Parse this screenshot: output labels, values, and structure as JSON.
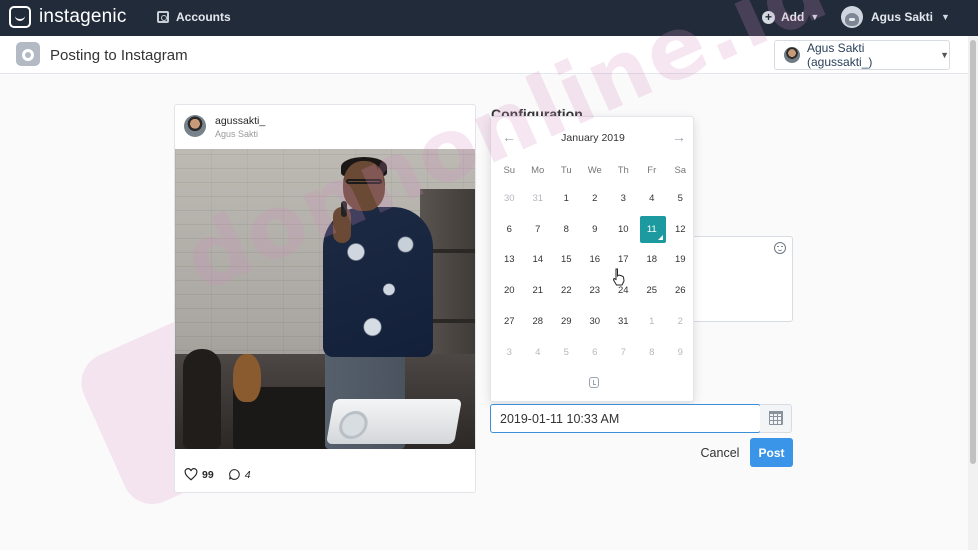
{
  "nav": {
    "brand": "instagenic",
    "accounts": "Accounts",
    "add": "Add",
    "user": "Agus Sakti"
  },
  "page": {
    "title": "Posting to Instagram",
    "account_select": "Agus Sakti (agussakti_)"
  },
  "post": {
    "username": "agussakti_",
    "fullname": "Agus Sakti",
    "likes": "99",
    "comments": "4"
  },
  "config": {
    "title": "Configuration"
  },
  "datepicker": {
    "month_label": "January 2019",
    "prev": "←",
    "next": "→",
    "weekdays": [
      "Su",
      "Mo",
      "Tu",
      "We",
      "Th",
      "Fr",
      "Sa"
    ],
    "days": [
      {
        "d": "30",
        "other": true
      },
      {
        "d": "31",
        "other": true
      },
      {
        "d": "1"
      },
      {
        "d": "2"
      },
      {
        "d": "3"
      },
      {
        "d": "4"
      },
      {
        "d": "5"
      },
      {
        "d": "6"
      },
      {
        "d": "7"
      },
      {
        "d": "8"
      },
      {
        "d": "9"
      },
      {
        "d": "10"
      },
      {
        "d": "11",
        "selected": true
      },
      {
        "d": "12"
      },
      {
        "d": "13"
      },
      {
        "d": "14"
      },
      {
        "d": "15"
      },
      {
        "d": "16"
      },
      {
        "d": "17"
      },
      {
        "d": "18"
      },
      {
        "d": "19"
      },
      {
        "d": "20"
      },
      {
        "d": "21"
      },
      {
        "d": "22"
      },
      {
        "d": "23"
      },
      {
        "d": "24"
      },
      {
        "d": "25"
      },
      {
        "d": "26"
      },
      {
        "d": "27"
      },
      {
        "d": "28"
      },
      {
        "d": "29"
      },
      {
        "d": "30"
      },
      {
        "d": "31"
      },
      {
        "d": "1",
        "other": true
      },
      {
        "d": "2",
        "other": true
      },
      {
        "d": "3",
        "other": true
      },
      {
        "d": "4",
        "other": true
      },
      {
        "d": "5",
        "other": true
      },
      {
        "d": "6",
        "other": true
      },
      {
        "d": "7",
        "other": true
      },
      {
        "d": "8",
        "other": true
      },
      {
        "d": "9",
        "other": true
      }
    ],
    "selected_color": "#1d9aa0"
  },
  "schedule": {
    "value": "2019-01-11 10:33 AM"
  },
  "buttons": {
    "cancel": "Cancel",
    "post": "Post",
    "post_color": "#3a95e8"
  },
  "watermark": "donnonline.id"
}
